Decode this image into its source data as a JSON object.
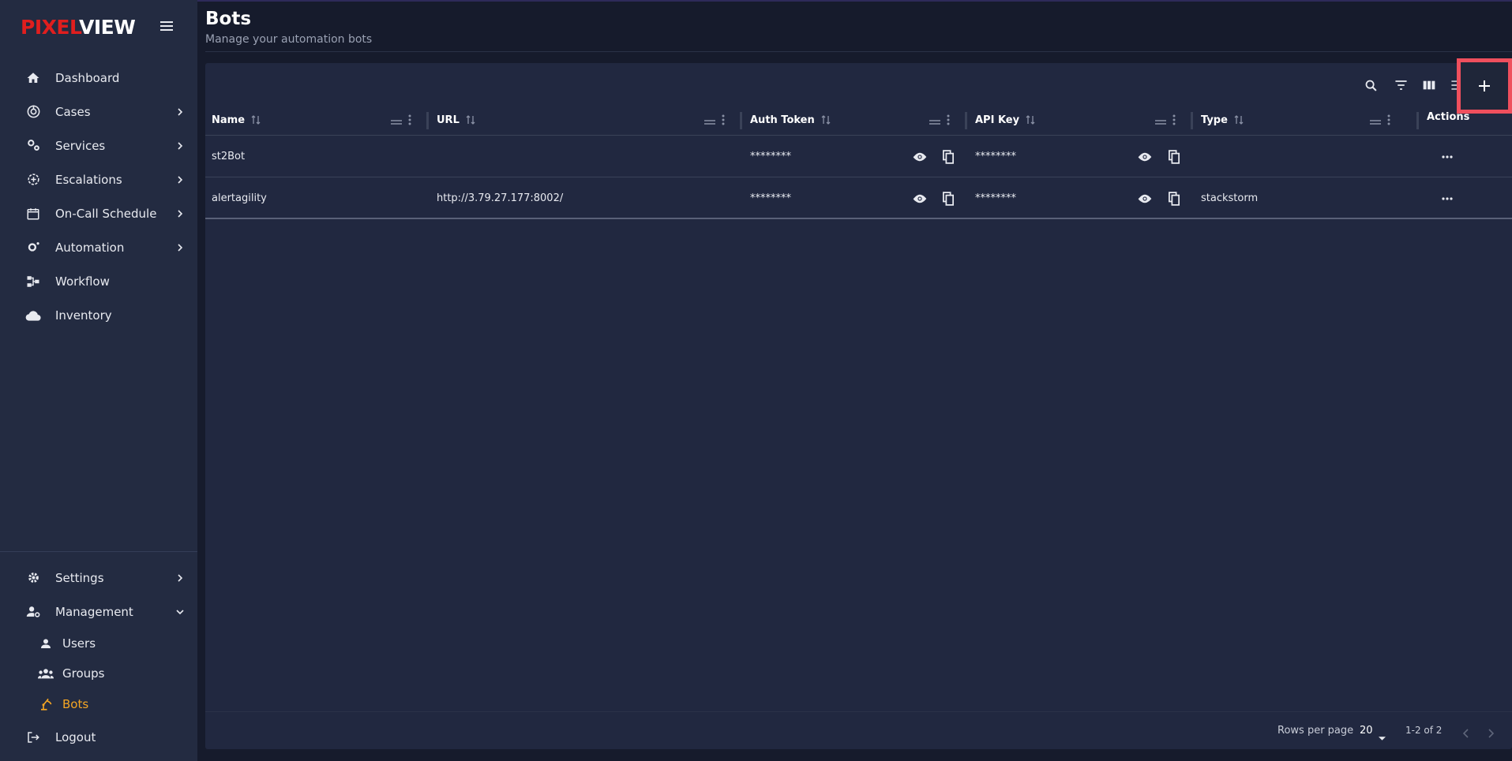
{
  "brand": {
    "part1": "PIXEL",
    "part2": "VIEW"
  },
  "sidebar": {
    "items": [
      {
        "label": "Dashboard"
      },
      {
        "label": "Cases"
      },
      {
        "label": "Services"
      },
      {
        "label": "Escalations"
      },
      {
        "label": "On-Call Schedule"
      },
      {
        "label": "Automation"
      },
      {
        "label": "Workflow"
      },
      {
        "label": "Inventory"
      }
    ],
    "bottom": [
      {
        "label": "Settings"
      },
      {
        "label": "Management"
      }
    ],
    "management_sub": [
      {
        "label": "Users"
      },
      {
        "label": "Groups"
      },
      {
        "label": "Bots"
      }
    ],
    "logout": "Logout"
  },
  "header": {
    "title": "Bots",
    "subtitle": "Manage your automation bots"
  },
  "table": {
    "columns": [
      "Name",
      "URL",
      "Auth Token",
      "API Key",
      "Type",
      "Actions"
    ],
    "rows": [
      {
        "name": "st2Bot",
        "url": "",
        "auth": "********",
        "api": "********",
        "type": ""
      },
      {
        "name": "alertagility",
        "url": "http://3.79.27.177:8002/",
        "auth": "********",
        "api": "********",
        "type": "stackstorm"
      }
    ]
  },
  "pagination": {
    "rows_label": "Rows per page",
    "rows_value": "20",
    "range": "1-2 of 2"
  },
  "colors": {
    "brand_red": "#e01e1e",
    "active": "#f5a623",
    "highlight": "#ef4f5d"
  }
}
